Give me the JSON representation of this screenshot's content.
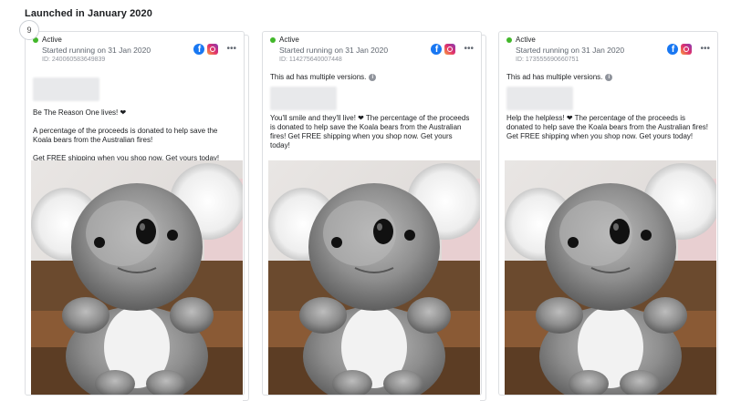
{
  "section": {
    "title": "Launched in January 2020",
    "count": "9"
  },
  "cards": [
    {
      "status": "Active",
      "started": "Started running on 31 Jan 2020",
      "id": "ID: 240060583649839",
      "multiple": "",
      "headline": "Be The Reason One lives! ❤",
      "body": "A percentage of the proceeds is donated to help save the Koala bears from the Australian fires!",
      "cta": "Get FREE shipping when you shop now. Get yours today!"
    },
    {
      "status": "Active",
      "started": "Started running on 31 Jan 2020",
      "id": "ID: 114275640007448",
      "multiple": "This ad has multiple versions.",
      "headline": "",
      "body": "You'll smile and they'll live! ❤ The percentage of the proceeds is donated to help save the Koala bears from the Australian fires! Get FREE shipping when you shop now. Get yours today!",
      "cta": ""
    },
    {
      "status": "Active",
      "started": "Started running on 31 Jan 2020",
      "id": "ID: 173555690660751",
      "multiple": "This ad has multiple versions.",
      "headline": "",
      "body": "Help the helpless! ❤ The percentage of the proceeds is donated to help save the Koala bears from the Australian fires! Get FREE shipping when you shop now. Get yours today!",
      "cta": ""
    }
  ],
  "icons": {
    "facebook": "facebook-icon",
    "instagram": "instagram-icon",
    "more": "more-options-icon",
    "info": "info-icon"
  },
  "colors": {
    "active": "#42b72a",
    "facebook": "#1877f2",
    "border": "#dddfe2"
  }
}
